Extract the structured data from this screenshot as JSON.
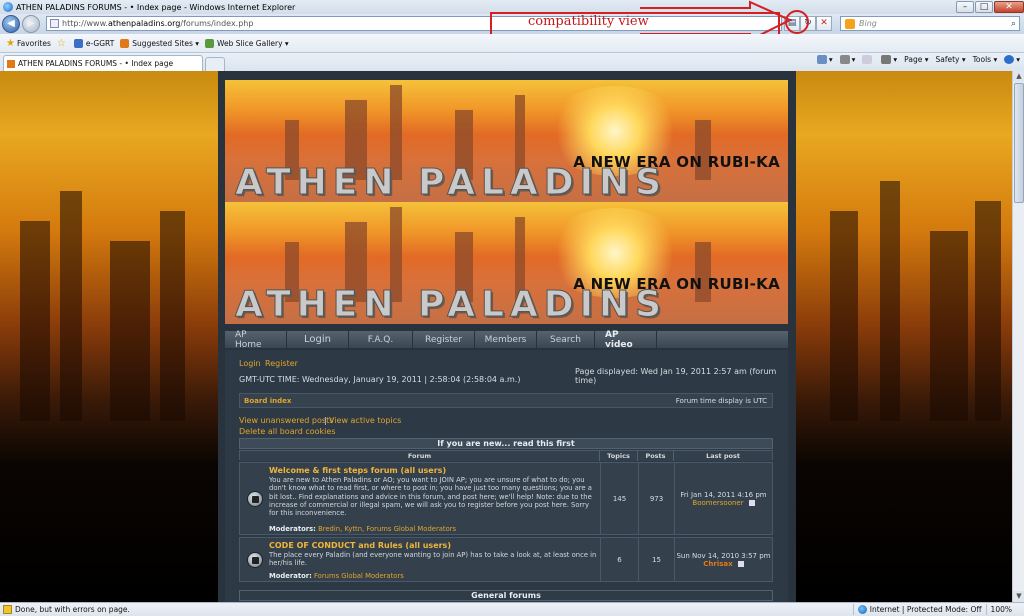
{
  "window": {
    "title": "ATHEN PALADINS FORUMS - • Index page - Windows Internet Explorer",
    "address_prefix": "http://www.",
    "address_domain": "athenpaladins.org",
    "address_path": "/forums/index.php",
    "search_placeholder": "Bing"
  },
  "annotation": {
    "label": "compatibility view",
    "color": "#d42020"
  },
  "favorites_bar": {
    "favorites_label": "Favorites",
    "items": [
      "e-GGRT",
      "Suggested Sites ▾",
      "Web Slice Gallery ▾"
    ]
  },
  "tab": {
    "label": "ATHEN PALADINS FORUMS - • Index page"
  },
  "command_bar": [
    "Page ▾",
    "Safety ▾",
    "Tools ▾"
  ],
  "banner": {
    "tagline": "A NEW ERA ON RUBI-KA",
    "title": "ATHEN PALADINS"
  },
  "nav_menu": [
    "AP Home",
    "Login",
    "F.A.Q.",
    "Register",
    "Members",
    "Search",
    "AP video"
  ],
  "forum": {
    "login_link": "Login",
    "register_link": "Register",
    "time_line": "GMT-UTC TIME: Wednesday, January 19, 2011  |  2:58:04   (2:58:04 a.m.)",
    "page_displayed": "Page displayed: Wed Jan 19, 2011 2:57 am (forum time)",
    "board_index": "Board index",
    "timezone_note": "Forum time display is UTC",
    "view_unanswered": "View unanswered posts",
    "separator": "|",
    "view_active": "View active topics",
    "delete_cookies": "Delete all board cookies",
    "new_header": "If you are new... read this first",
    "col_forum": "Forum",
    "col_topics": "Topics",
    "col_posts": "Posts",
    "col_lastpost": "Last post",
    "rows": [
      {
        "title": "Welcome & first steps forum (all users)",
        "desc": "You are new to Athen Paladins or AO; you want to JOIN AP; you are unsure of what to do; you don't know what to read first, or where to post in; you have just too many questions; you are a bit lost.. Find explanations and advice in this forum, and post here; we'll help! Note: due to the increase of commercial or illegal spam, we will ask you to register before you post here. Sorry for this inconvenience.",
        "mod_label": "Moderators:",
        "mods": "Bredin, Kyttn, Forums Global Moderators",
        "topics": "145",
        "posts": "973",
        "last_date": "Fri Jan 14, 2011 4:16 pm",
        "last_user": "Boomersooner"
      },
      {
        "title": "CODE OF CONDUCT and Rules (all users)",
        "desc": "The place every Paladin (and everyone wanting to join AP) has to take a look at, at least once in her/his life.",
        "mod_label": "Moderator:",
        "mods": "Forums Global Moderators",
        "topics": "6",
        "posts": "15",
        "last_date": "Sun Nov 14, 2010 3:57 pm",
        "last_user": "Chrisax"
      }
    ],
    "general_header": "General forums"
  },
  "status_bar": {
    "message": "Done, but with errors on page.",
    "zone": "Internet | Protected Mode: Off",
    "zoom": "100%"
  }
}
